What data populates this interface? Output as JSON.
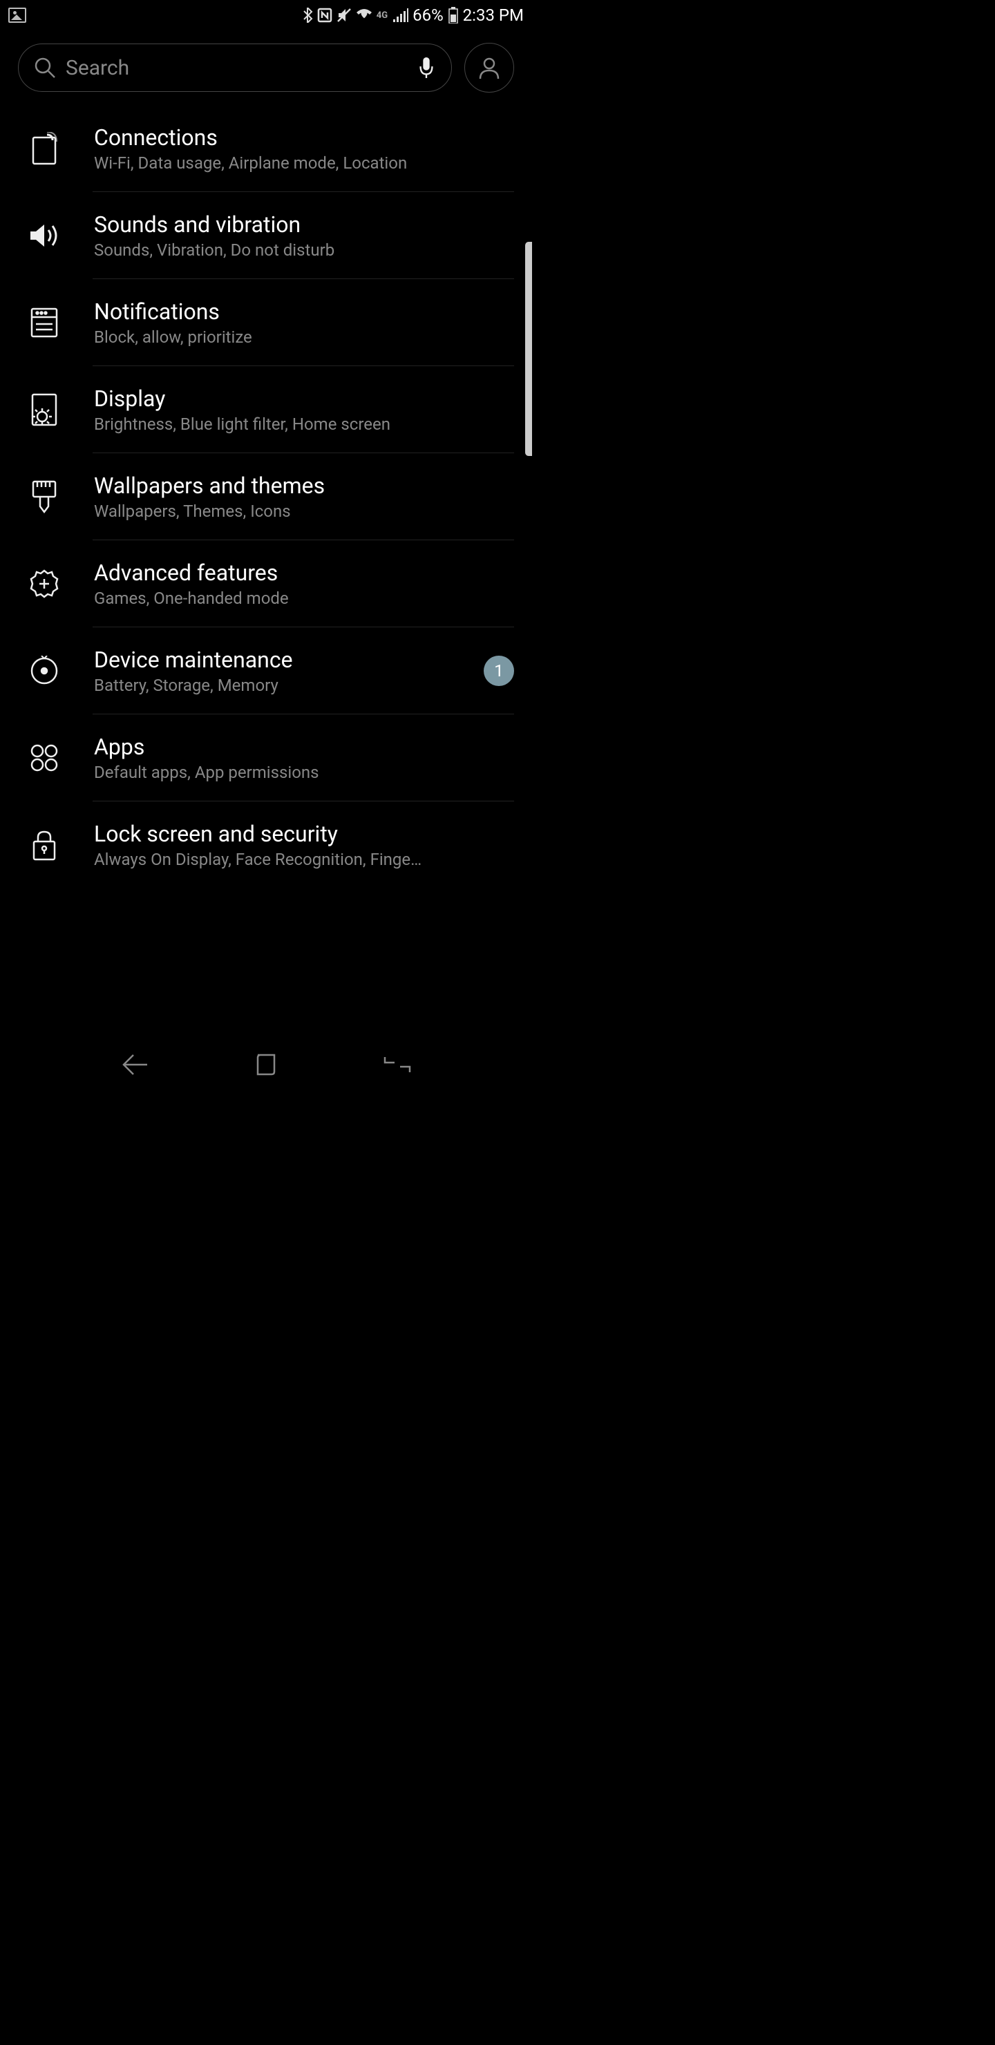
{
  "status_bar": {
    "battery_percent": "66%",
    "time": "2:33 PM",
    "network": "4G"
  },
  "search": {
    "placeholder": "Search"
  },
  "settings": [
    {
      "id": "connections",
      "title": "Connections",
      "subtitle": "Wi-Fi, Data usage, Airplane mode, Location",
      "badge": null
    },
    {
      "id": "sounds",
      "title": "Sounds and vibration",
      "subtitle": "Sounds, Vibration, Do not disturb",
      "badge": null
    },
    {
      "id": "notifications",
      "title": "Notifications",
      "subtitle": "Block, allow, prioritize",
      "badge": null
    },
    {
      "id": "display",
      "title": "Display",
      "subtitle": "Brightness, Blue light filter, Home screen",
      "badge": null
    },
    {
      "id": "wallpapers",
      "title": "Wallpapers and themes",
      "subtitle": "Wallpapers, Themes, Icons",
      "badge": null
    },
    {
      "id": "advanced",
      "title": "Advanced features",
      "subtitle": "Games, One-handed mode",
      "badge": null
    },
    {
      "id": "maintenance",
      "title": "Device maintenance",
      "subtitle": "Battery, Storage, Memory",
      "badge": "1"
    },
    {
      "id": "apps",
      "title": "Apps",
      "subtitle": "Default apps, App permissions",
      "badge": null
    },
    {
      "id": "security",
      "title": "Lock screen and security",
      "subtitle": "Always On Display, Face Recognition, Finge…",
      "badge": null
    }
  ]
}
